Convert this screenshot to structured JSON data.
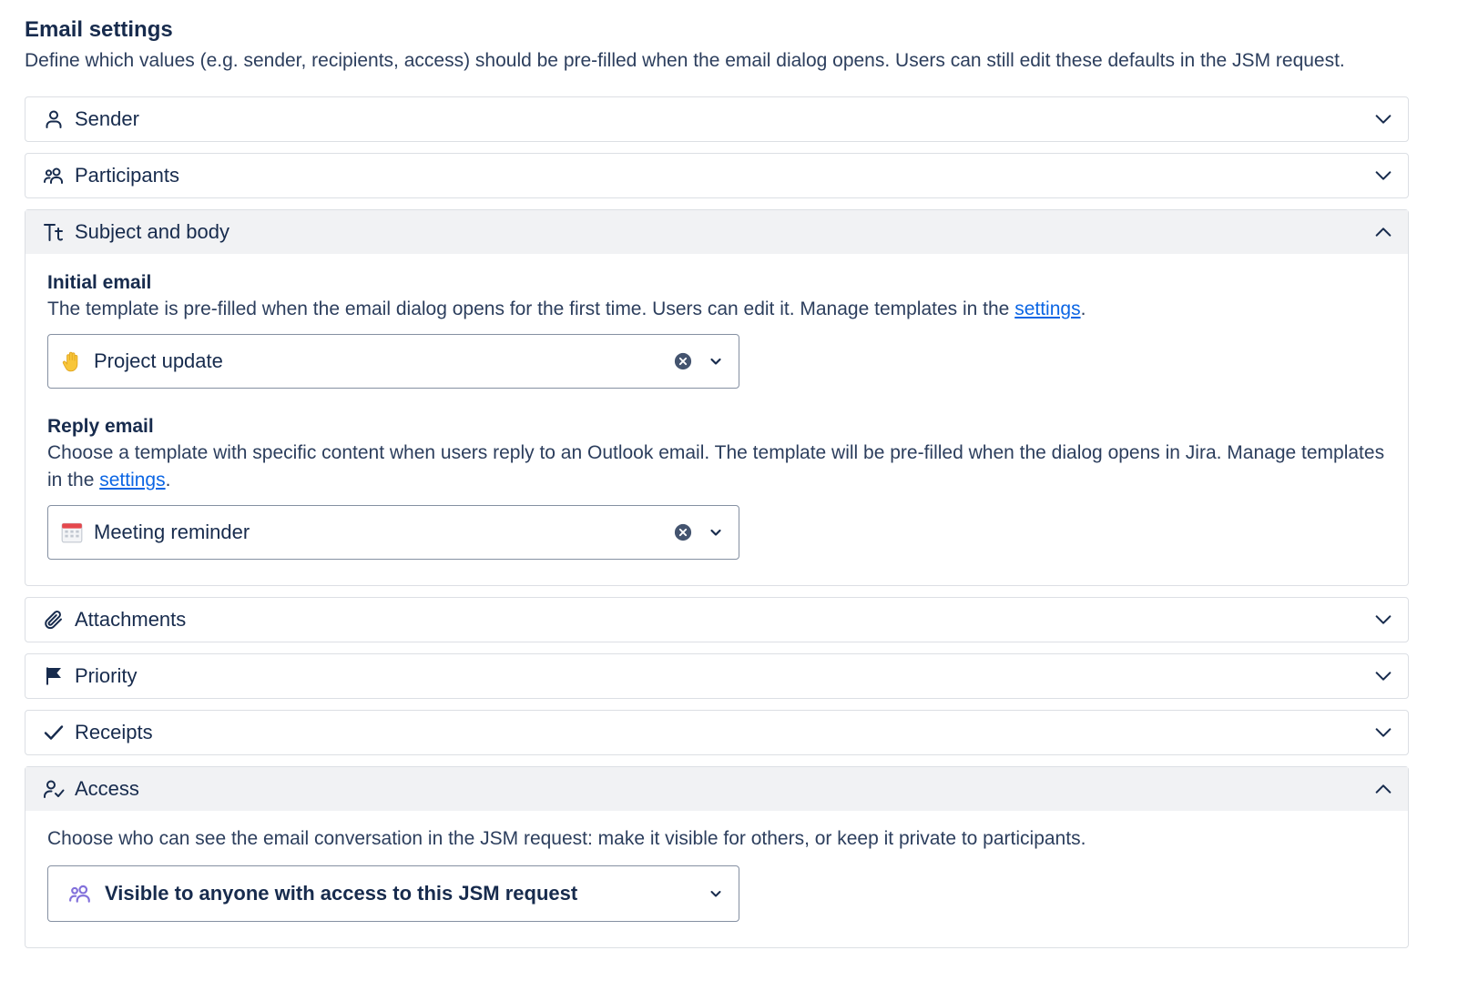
{
  "header": {
    "title": "Email settings",
    "description": "Define which values (e.g. sender, recipients, access) should be pre-filled when the email dialog opens. Users can still edit these defaults in the JSM request."
  },
  "sections": {
    "sender": {
      "label": "Sender",
      "icon": "person-icon"
    },
    "participants": {
      "label": "Participants",
      "icon": "people-icon"
    },
    "subject": {
      "label": "Subject and body",
      "icon": "text-size-icon",
      "initial": {
        "title": "Initial email",
        "desc": "The template is pre-filled when the email dialog opens for the first time. Users can edit it. Manage templates in the ",
        "link": "settings",
        "after": ".",
        "value": "Project update",
        "emoji": "🖐️"
      },
      "reply": {
        "title": "Reply email",
        "desc": "Choose a template with specific content when users reply to an Outlook email. The template will be pre-filled when the dialog opens in Jira. Manage templates in the ",
        "link": "settings",
        "after": ".",
        "value": "Meeting reminder",
        "emoji": "📅"
      }
    },
    "attachments": {
      "label": "Attachments",
      "icon": "paperclip-icon"
    },
    "priority": {
      "label": "Priority",
      "icon": "flag-icon"
    },
    "receipts": {
      "label": "Receipts",
      "icon": "check-icon"
    },
    "access": {
      "label": "Access",
      "icon": "person-check-icon",
      "desc": "Choose who can see the email conversation in the JSM request: make it visible for others, or keep it private to participants.",
      "value": "Visible to anyone with access to this JSM request"
    }
  },
  "colors": {
    "text": "#172b4d",
    "link": "#0c66e4",
    "border": "#dcdfe4",
    "header_bg": "#f1f2f4",
    "accent_icon": "#8270db"
  }
}
